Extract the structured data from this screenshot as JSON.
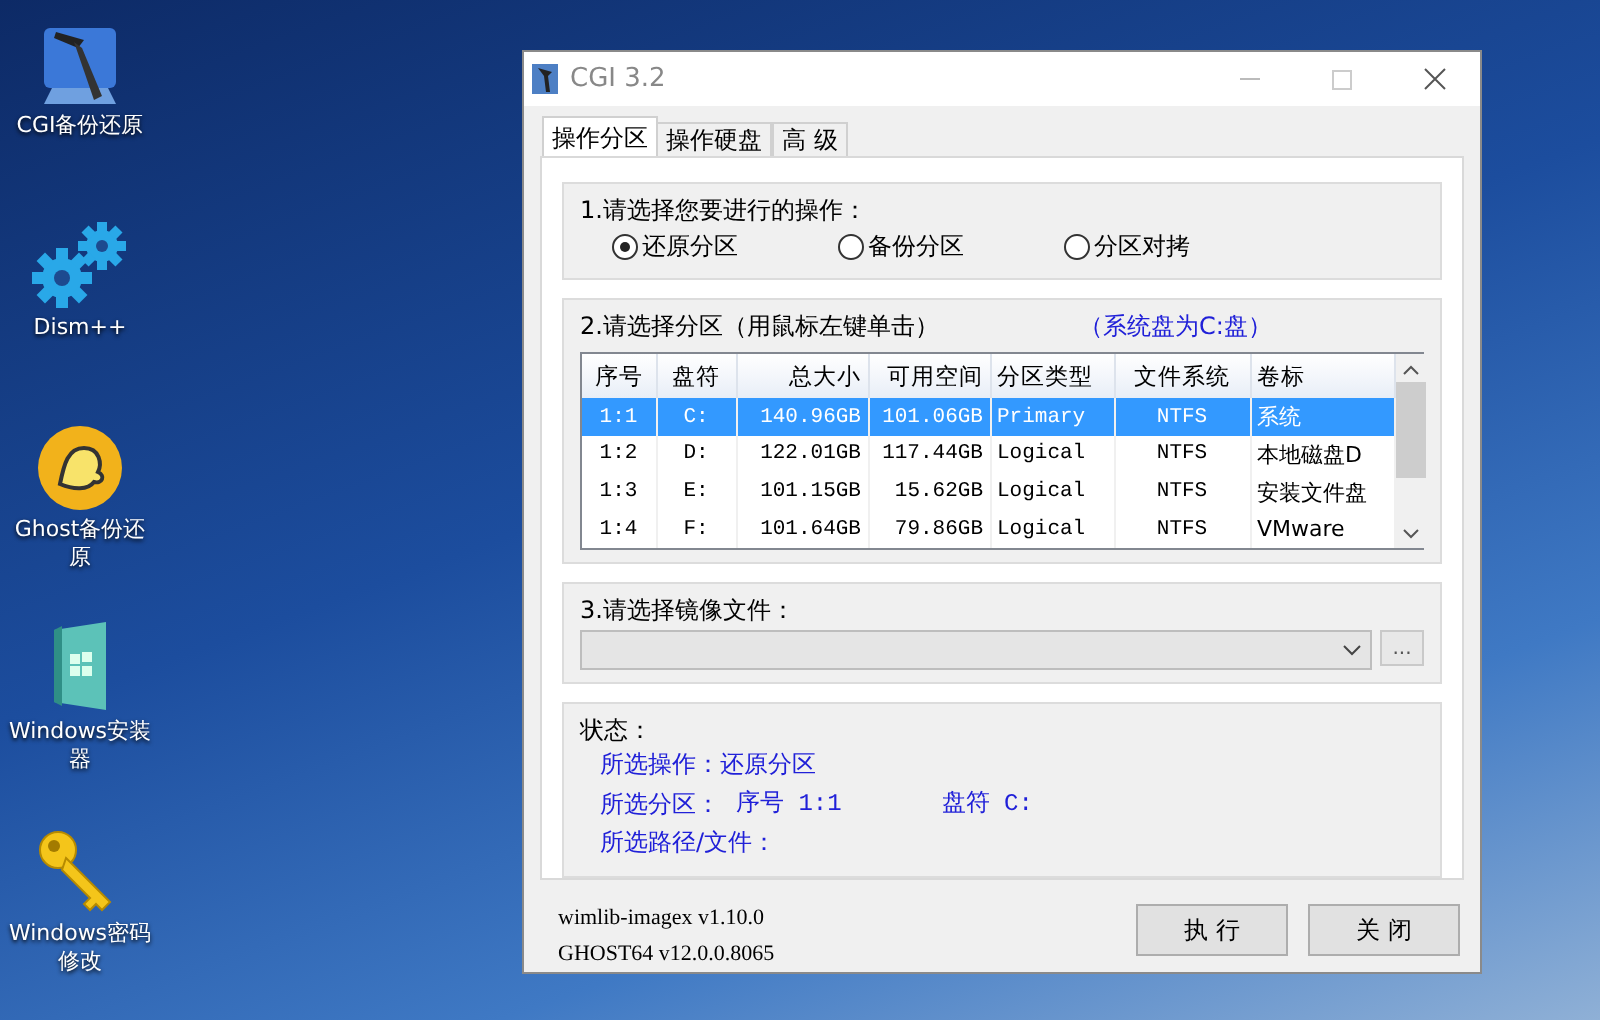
{
  "desktop_icons": [
    {
      "kind": "hammer",
      "label": "CGI备份还原"
    },
    {
      "kind": "gears",
      "label": "Dism++"
    },
    {
      "kind": "ghost",
      "label": "Ghost备份还原"
    },
    {
      "kind": "installer",
      "label": "Windows安装器"
    },
    {
      "kind": "key",
      "label": "Windows密码修改"
    }
  ],
  "window": {
    "title": "CGI 3.2",
    "tabs": [
      {
        "label": "操作分区",
        "selected": true
      },
      {
        "label": "操作硬盘",
        "selected": false
      },
      {
        "label": "高 级",
        "selected": false
      }
    ],
    "operation": {
      "title": "1.请选择您要进行的操作：",
      "options": [
        {
          "label": "还原分区",
          "selected": true
        },
        {
          "label": "备份分区",
          "selected": false
        },
        {
          "label": "分区对拷",
          "selected": false
        }
      ]
    },
    "partition": {
      "title": "2.请选择分区（用鼠标左键单击）",
      "note": "（系统盘为C:盘）",
      "table": {
        "columns": [
          "序号",
          "盘符",
          "总大小",
          "可用空间",
          "分区类型",
          "文件系统",
          "卷标"
        ],
        "rows": [
          {
            "cells": [
              "1:1",
              "C:",
              "140.96GB",
              "101.06GB",
              "Primary",
              "NTFS",
              "系统"
            ],
            "selected": true
          },
          {
            "cells": [
              "1:2",
              "D:",
              "122.01GB",
              "117.44GB",
              "Logical",
              "NTFS",
              "本地磁盘D"
            ],
            "selected": false
          },
          {
            "cells": [
              "1:3",
              "E:",
              "101.15GB",
              "15.62GB",
              "Logical",
              "NTFS",
              "安装文件盘"
            ],
            "selected": false
          },
          {
            "cells": [
              "1:4",
              "F:",
              "101.64GB",
              "79.86GB",
              "Logical",
              "NTFS",
              "VMware"
            ],
            "selected": false
          }
        ]
      }
    },
    "image_file": {
      "title": "3.请选择镜像文件：",
      "browse_button": "..."
    },
    "status": {
      "title": "状态：",
      "lines": [
        {
          "parts": [
            "所选操作：还原分区"
          ]
        },
        {
          "parts": [
            "所选分区：",
            "序号 1:1",
            "盘符 C:"
          ]
        },
        {
          "parts": [
            "所选路径/文件："
          ]
        }
      ]
    },
    "versions": [
      "wimlib-imagex v1.10.0",
      "GHOST64 v12.0.0.8065"
    ],
    "buttons": [
      "执 行",
      "关 闭"
    ]
  }
}
